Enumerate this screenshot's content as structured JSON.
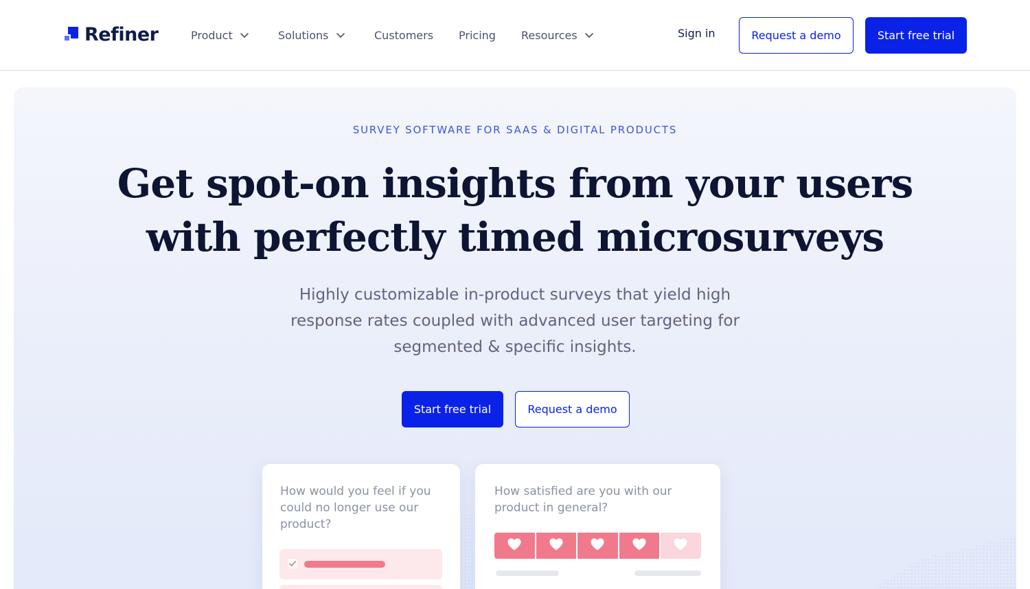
{
  "brand": {
    "name": "Refiner",
    "accent": "#0a22e8",
    "heart_color": "#f07a8c"
  },
  "nav": {
    "items": [
      {
        "label": "Product",
        "dropdown": true
      },
      {
        "label": "Solutions",
        "dropdown": true
      },
      {
        "label": "Customers",
        "dropdown": false
      },
      {
        "label": "Pricing",
        "dropdown": false
      },
      {
        "label": "Resources",
        "dropdown": true
      }
    ],
    "sign_in": "Sign in",
    "request_demo": "Request a demo",
    "start_trial": "Start free trial"
  },
  "hero": {
    "eyebrow": "SURVEY SOFTWARE FOR SAAS & DIGITAL PRODUCTS",
    "headline_line1": "Get spot-on insights from your users",
    "headline_line2": "with perfectly timed microsurveys",
    "subtitle": "Highly customizable in-product surveys that yield high response rates coupled with advanced user targeting for segmented & specific insights.",
    "cta_primary": "Start free trial",
    "cta_secondary": "Request a demo"
  },
  "survey_cards": [
    {
      "question": "How would you feel if you could no longer use our product?",
      "type": "multiple-choice",
      "icon": "check-icon"
    },
    {
      "question": "How satisfied are you with our product in general?",
      "type": "rating",
      "icon": "heart-icon",
      "rating_value": 4,
      "rating_max": 5
    }
  ]
}
